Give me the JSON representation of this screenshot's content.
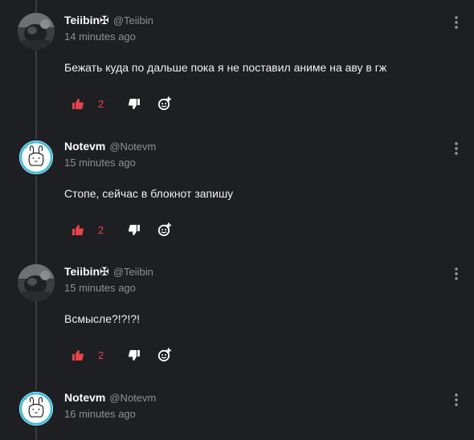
{
  "comments": [
    {
      "author": "Teiibin✠",
      "handle": "@Teiibin",
      "time": "14 minutes ago",
      "text": "Бежать куда по дальше пока я не поставил аниме на аву в гж",
      "likes": "2",
      "avatar": "dark-photo"
    },
    {
      "author": "Notevm",
      "handle": "@Notevm",
      "time": "15 minutes ago",
      "text": "Стопе, сейчас в блокнот запишу",
      "likes": "2",
      "avatar": "bunny"
    },
    {
      "author": "Teiibin✠",
      "handle": "@Teiibin",
      "time": "15 minutes ago",
      "text": "Всмысле?!?!?!",
      "likes": "2",
      "avatar": "dark-photo"
    },
    {
      "author": "Notevm",
      "handle": "@Notevm",
      "time": "16 minutes ago",
      "text": "",
      "likes": "",
      "avatar": "bunny"
    }
  ],
  "colors": {
    "background": "#1e1f22",
    "like_active": "#e8424a",
    "muted": "#8e9095"
  },
  "icons": {
    "like": "thumbs-up-icon",
    "dislike": "thumbs-down-icon",
    "react": "add-reaction-icon",
    "more": "more-vertical-icon"
  }
}
